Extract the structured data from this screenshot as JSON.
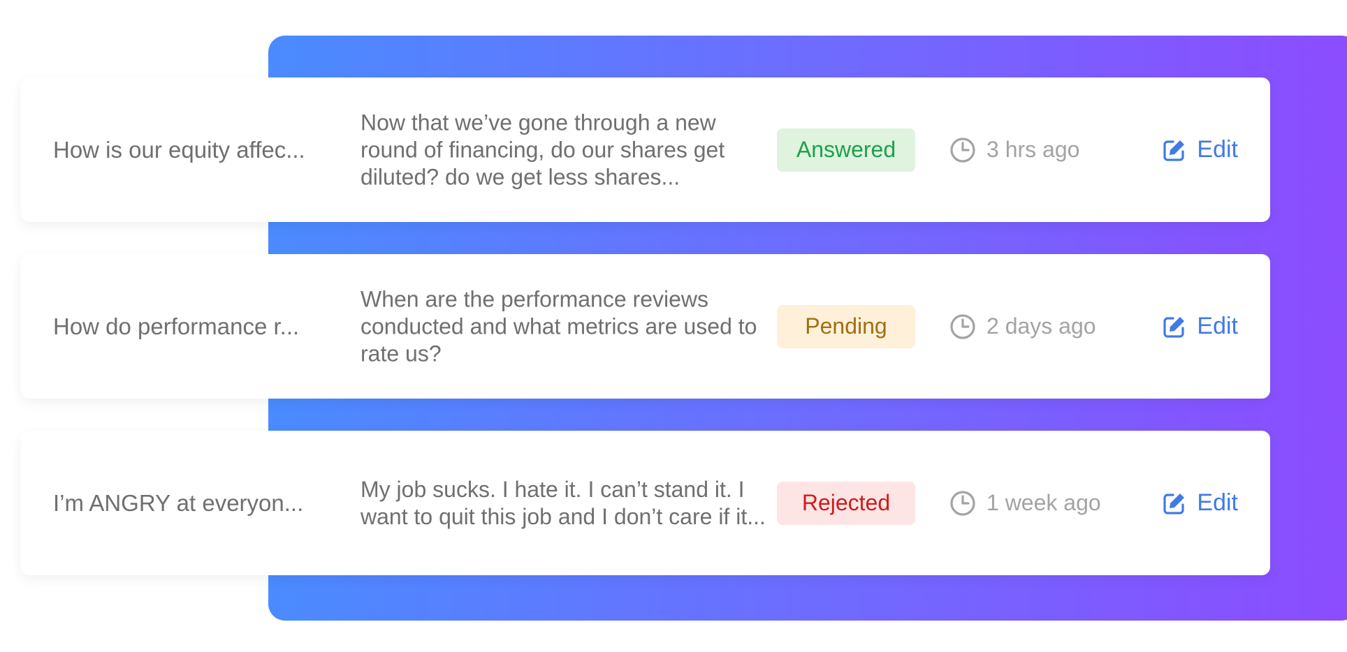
{
  "colors": {
    "gradient_start": "#4a8bff",
    "gradient_end": "#8c4cff",
    "text_primary": "#6f6f6f",
    "text_muted": "#a3a3a3",
    "link": "#3f7ae6"
  },
  "items": [
    {
      "title": "How is our equity affec...",
      "description": "Now that we’ve gone through a new round of financing, do our shares get diluted? do we get less shares...",
      "status": "Answered",
      "status_color": "#1ea04a",
      "status_bg": "#dff3df",
      "time": "3 hrs ago",
      "edit_label": "Edit",
      "icons": {
        "clock": "clock-icon",
        "edit": "edit-icon"
      }
    },
    {
      "title": "How do performance r...",
      "description": "When are the performance reviews conducted and what metrics are used to rate us?",
      "status": "Pending",
      "status_color": "#a06f12",
      "status_bg": "#fff0da",
      "time": "2 days ago",
      "edit_label": "Edit",
      "icons": {
        "clock": "clock-icon",
        "edit": "edit-icon"
      }
    },
    {
      "title": "I’m ANGRY at everyon...",
      "description": "My job sucks. I hate it. I can’t stand it. I want to quit this job and I don’t care if it...",
      "status": "Rejected",
      "status_color": "#d11a1a",
      "status_bg": "#fde5e5",
      "time": "1 week ago",
      "edit_label": "Edit",
      "icons": {
        "clock": "clock-icon",
        "edit": "edit-icon"
      }
    }
  ]
}
